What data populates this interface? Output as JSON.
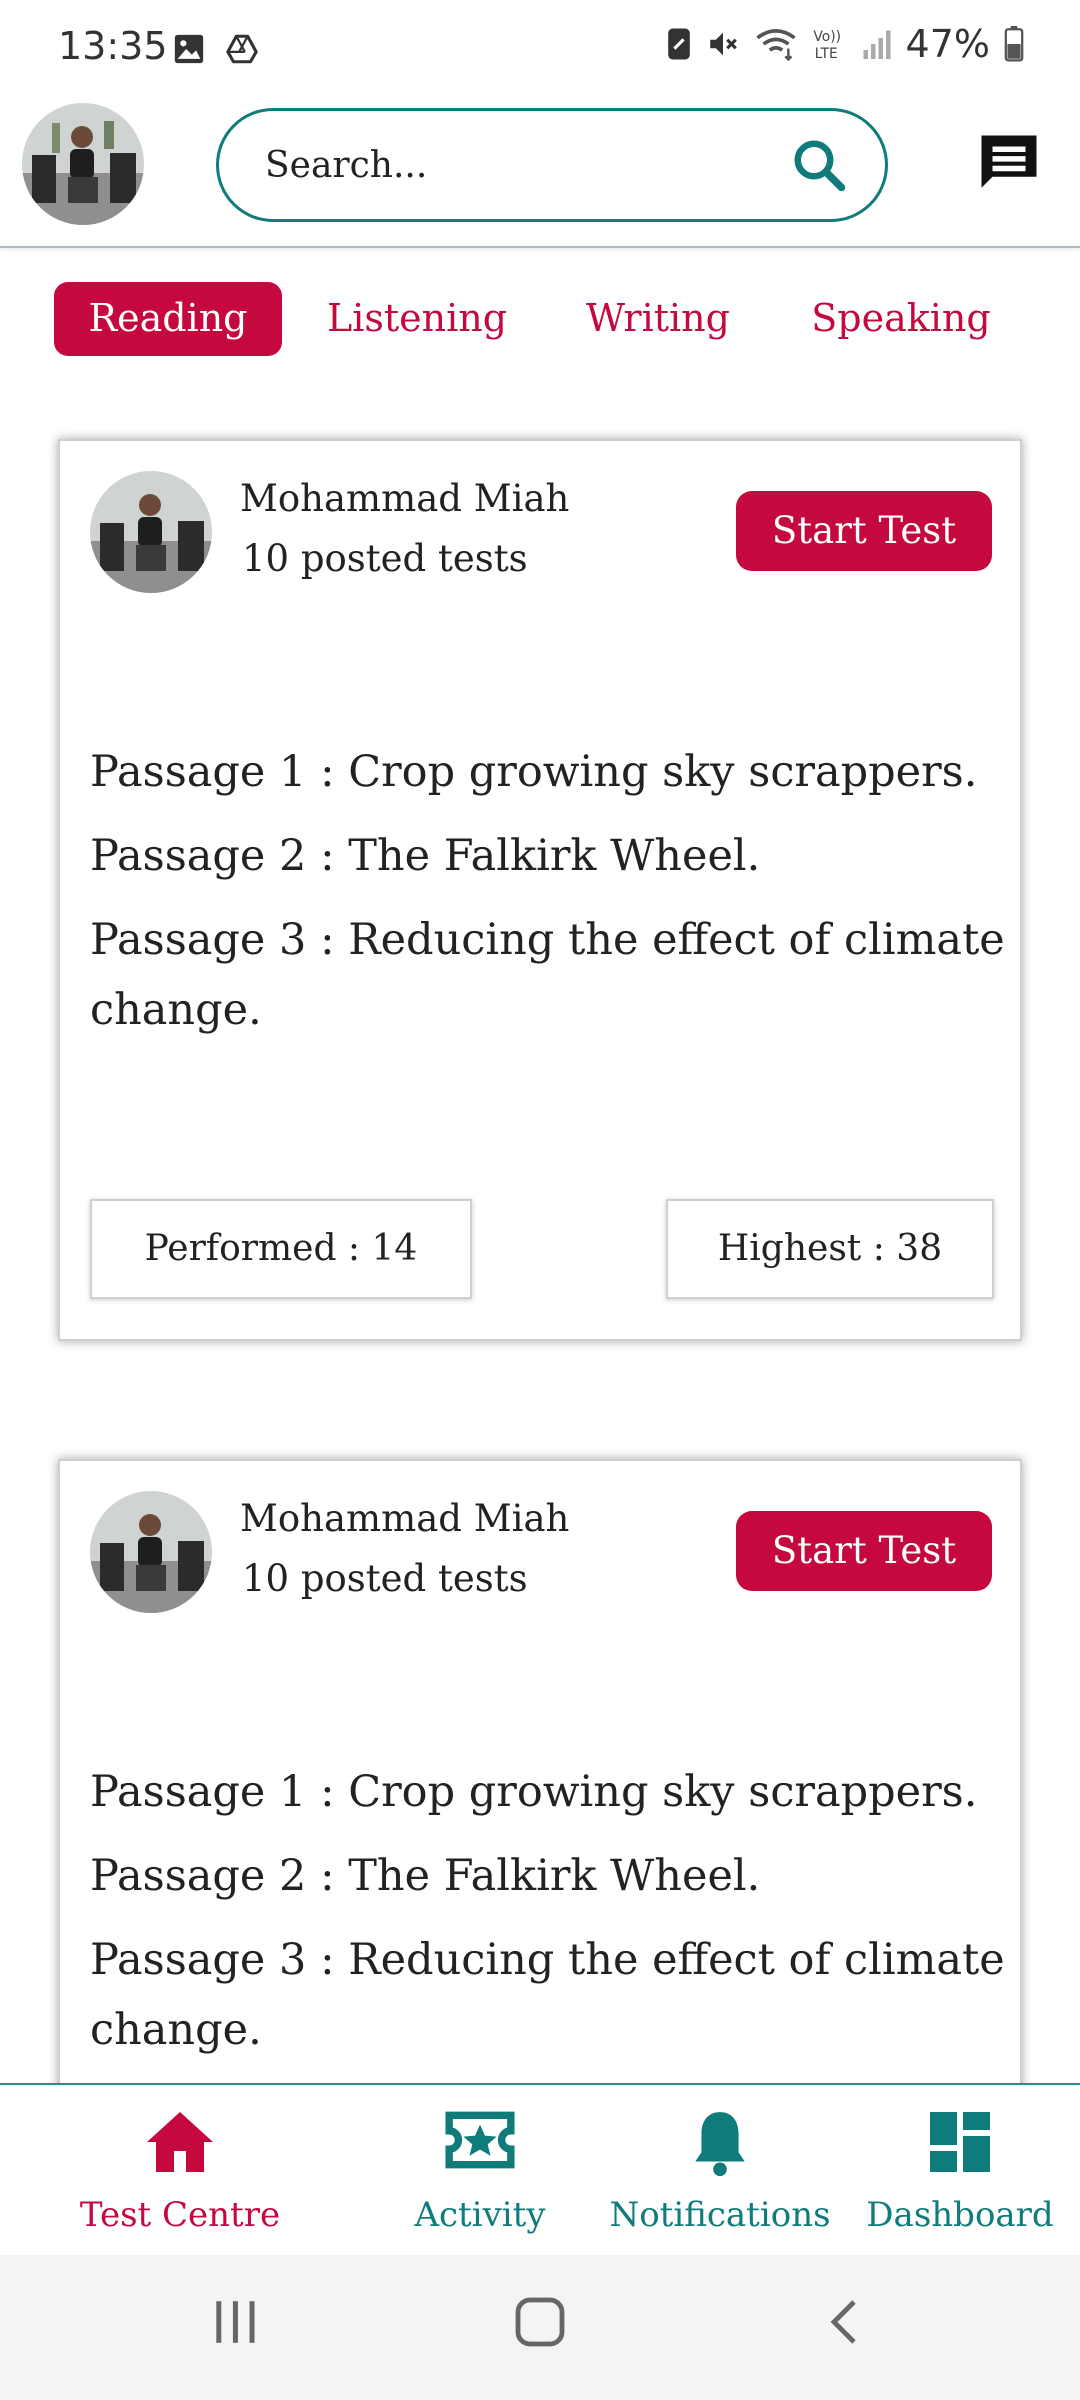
{
  "status_bar": {
    "time": "13:35",
    "battery": "47%",
    "left_icons": [
      "gallery-icon",
      "drive-icon"
    ],
    "right_icons": [
      "nfc-icon",
      "mute-icon",
      "wifi-icon",
      "volte-icon",
      "signal-icon",
      "battery-icon"
    ]
  },
  "header": {
    "search_placeholder": "Search...",
    "icons": [
      "avatar",
      "search-icon",
      "chat-icon"
    ]
  },
  "tabs": [
    {
      "label": "Reading",
      "active": true
    },
    {
      "label": "Listening",
      "active": false
    },
    {
      "label": "Writing",
      "active": false
    },
    {
      "label": "Speaking",
      "active": false
    }
  ],
  "cards": [
    {
      "author": "Mohammad Miah",
      "posted": "10 posted tests",
      "button": "Start Test",
      "passages": [
        "Passage 1 : Crop growing sky scrappers.",
        "Passage 2 : The Falkirk Wheel.",
        "Passage 3 : Reducing the effect of climate change."
      ],
      "performed": "Performed : 14",
      "highest": "Highest : 38"
    },
    {
      "author": "Mohammad Miah",
      "posted": "10 posted tests",
      "button": "Start Test",
      "passages": [
        "Passage 1 : Crop growing sky scrappers.",
        "Passage 2 : The Falkirk Wheel.",
        "Passage 3 : Reducing the effect of climate change."
      ]
    }
  ],
  "bottom_nav": [
    {
      "label": "Test Centre",
      "icon": "home-icon",
      "active": true
    },
    {
      "label": "Activity",
      "icon": "ticket-star-icon",
      "active": false
    },
    {
      "label": "Notifications",
      "icon": "bell-icon",
      "active": false
    },
    {
      "label": "Dashboard",
      "icon": "dashboard-icon",
      "active": false
    }
  ],
  "colors": {
    "accent": "#c5093f",
    "teal": "#0f7b7b",
    "text": "#222222"
  }
}
